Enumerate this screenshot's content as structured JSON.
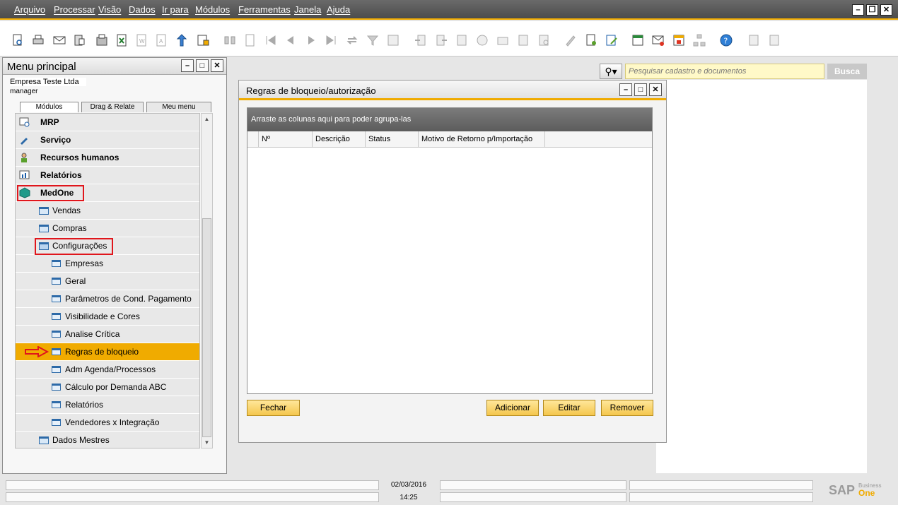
{
  "menubar": {
    "items": [
      "Arquivo",
      "Processar",
      "Visão",
      "Dados",
      "Ir para",
      "Módulos",
      "Ferramentas",
      "Janela",
      "Ajuda"
    ],
    "window_controls": [
      "–",
      "❐",
      "✕"
    ]
  },
  "main_menu": {
    "title": "Menu principal",
    "company": "Empresa Teste Ltda",
    "user": "manager",
    "tabs": [
      "Módulos",
      "Drag & Relate",
      "Meu menu"
    ],
    "tree": [
      {
        "label": "MRP",
        "level": 0,
        "bold": true,
        "icon": "mrp-icon"
      },
      {
        "label": "Serviço",
        "level": 0,
        "bold": true,
        "icon": "service-icon"
      },
      {
        "label": "Recursos humanos",
        "level": 0,
        "bold": true,
        "icon": "hr-icon"
      },
      {
        "label": "Relatórios",
        "level": 0,
        "bold": true,
        "icon": "reports-icon"
      },
      {
        "label": "MedOne",
        "level": 0,
        "bold": true,
        "icon": "medone-icon",
        "highlighted": true
      },
      {
        "label": "Vendas",
        "level": 1,
        "icon": "folder-icon"
      },
      {
        "label": "Compras",
        "level": 1,
        "icon": "folder-icon"
      },
      {
        "label": "Configurações",
        "level": 1,
        "icon": "folder-open-icon",
        "highlighted": true
      },
      {
        "label": "Empresas",
        "level": 2,
        "icon": "form-icon"
      },
      {
        "label": "Geral",
        "level": 2,
        "icon": "form-icon"
      },
      {
        "label": "Parâmetros de Cond. Pagamento",
        "level": 2,
        "icon": "form-icon"
      },
      {
        "label": "Visibilidade e Cores",
        "level": 2,
        "icon": "form-icon"
      },
      {
        "label": "Analise Crítica",
        "level": 2,
        "icon": "form-icon"
      },
      {
        "label": "Regras de bloqueio",
        "level": 2,
        "icon": "form-icon",
        "selected": true,
        "arrow": true
      },
      {
        "label": "Adm Agenda/Processos",
        "level": 2,
        "icon": "form-icon"
      },
      {
        "label": "Cálculo por Demanda ABC",
        "level": 2,
        "icon": "form-icon"
      },
      {
        "label": "Relatórios",
        "level": 2,
        "icon": "form-icon"
      },
      {
        "label": "Vendedores x Integração",
        "level": 2,
        "icon": "form-icon"
      },
      {
        "label": "Dados Mestres",
        "level": 1,
        "icon": "folder-icon"
      }
    ]
  },
  "search": {
    "placeholder": "Pesquisar cadastro e documentos",
    "button_label": "Busca"
  },
  "dialog": {
    "title": "Regras de bloqueio/autorização",
    "group_hint": "Arraste as colunas aqui para poder agrupa-las",
    "columns": [
      "Nº",
      "Descrição",
      "Status",
      "Motivo de Retorno p/Importação"
    ],
    "buttons": {
      "close": "Fechar",
      "add": "Adicionar",
      "edit": "Editar",
      "remove": "Remover"
    }
  },
  "statusbar": {
    "date": "02/03/2016",
    "time": "14:25"
  },
  "colors": {
    "accent": "#f0ab00",
    "highlight_box": "#e0161c",
    "menubar": "#555555"
  }
}
